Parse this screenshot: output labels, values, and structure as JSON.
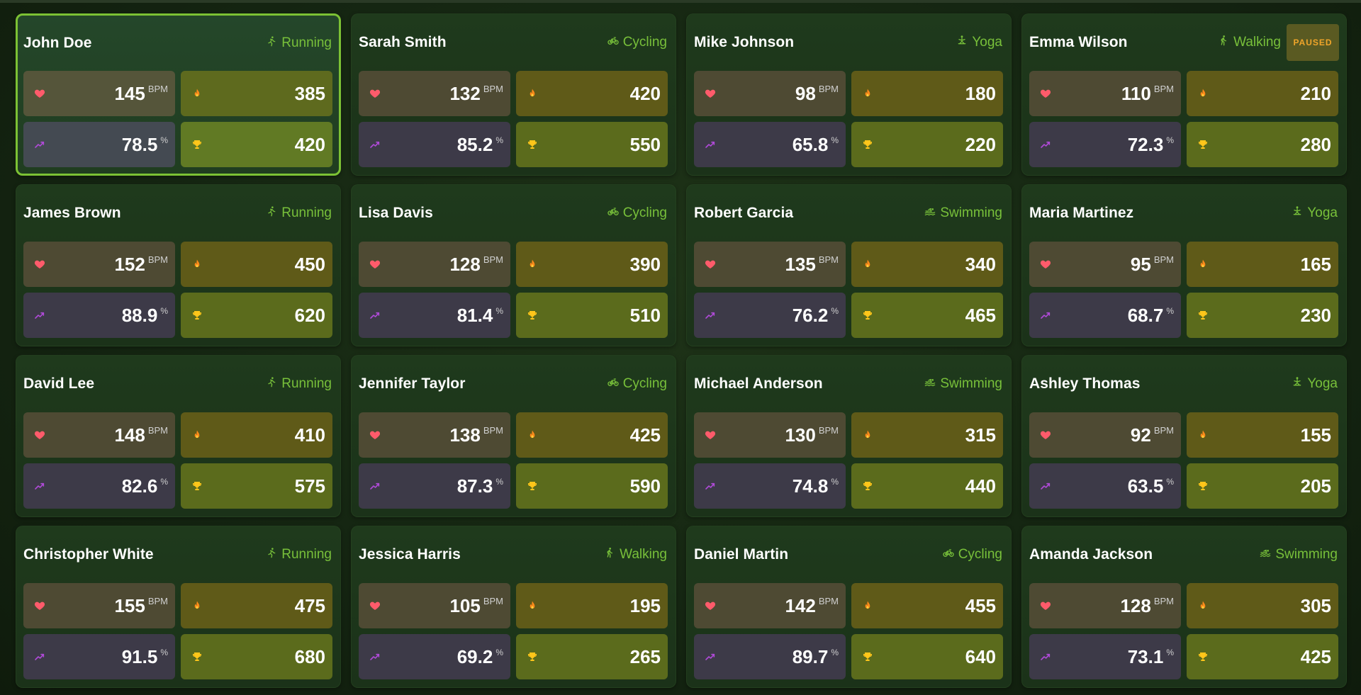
{
  "units": {
    "heart_rate": "BPM",
    "efficiency": "%"
  },
  "colors": {
    "accent": "#7cc234",
    "activity_text": "#78c03a",
    "paused_text": "#f0a52a",
    "heart_icon": "#ff5b6b",
    "flame_icon": "#ff8a1a",
    "trend_icon": "#b04ad8",
    "trophy_icon": "#ffc61a"
  },
  "icons": {
    "heart": "heart-icon",
    "calories": "flame-icon",
    "efficiency": "trend-up-icon",
    "score": "trophy-icon"
  },
  "cards": [
    {
      "name": "John Doe",
      "activity": "Running",
      "activity_icon": "running-icon",
      "heart_rate": "145",
      "calories": "385",
      "efficiency": "78.5",
      "score": "420",
      "selected": true,
      "status": ""
    },
    {
      "name": "Sarah Smith",
      "activity": "Cycling",
      "activity_icon": "cycling-icon",
      "heart_rate": "132",
      "calories": "420",
      "efficiency": "85.2",
      "score": "550",
      "selected": false,
      "status": ""
    },
    {
      "name": "Mike Johnson",
      "activity": "Yoga",
      "activity_icon": "yoga-icon",
      "heart_rate": "98",
      "calories": "180",
      "efficiency": "65.8",
      "score": "220",
      "selected": false,
      "status": ""
    },
    {
      "name": "Emma Wilson",
      "activity": "Walking",
      "activity_icon": "walking-icon",
      "heart_rate": "110",
      "calories": "210",
      "efficiency": "72.3",
      "score": "280",
      "selected": false,
      "status": "PAUSED"
    },
    {
      "name": "James Brown",
      "activity": "Running",
      "activity_icon": "running-icon",
      "heart_rate": "152",
      "calories": "450",
      "efficiency": "88.9",
      "score": "620",
      "selected": false,
      "status": ""
    },
    {
      "name": "Lisa Davis",
      "activity": "Cycling",
      "activity_icon": "cycling-icon",
      "heart_rate": "128",
      "calories": "390",
      "efficiency": "81.4",
      "score": "510",
      "selected": false,
      "status": ""
    },
    {
      "name": "Robert Garcia",
      "activity": "Swimming",
      "activity_icon": "swimming-icon",
      "heart_rate": "135",
      "calories": "340",
      "efficiency": "76.2",
      "score": "465",
      "selected": false,
      "status": ""
    },
    {
      "name": "Maria Martinez",
      "activity": "Yoga",
      "activity_icon": "yoga-icon",
      "heart_rate": "95",
      "calories": "165",
      "efficiency": "68.7",
      "score": "230",
      "selected": false,
      "status": ""
    },
    {
      "name": "David Lee",
      "activity": "Running",
      "activity_icon": "running-icon",
      "heart_rate": "148",
      "calories": "410",
      "efficiency": "82.6",
      "score": "575",
      "selected": false,
      "status": ""
    },
    {
      "name": "Jennifer Taylor",
      "activity": "Cycling",
      "activity_icon": "cycling-icon",
      "heart_rate": "138",
      "calories": "425",
      "efficiency": "87.3",
      "score": "590",
      "selected": false,
      "status": ""
    },
    {
      "name": "Michael Anderson",
      "activity": "Swimming",
      "activity_icon": "swimming-icon",
      "heart_rate": "130",
      "calories": "315",
      "efficiency": "74.8",
      "score": "440",
      "selected": false,
      "status": ""
    },
    {
      "name": "Ashley Thomas",
      "activity": "Yoga",
      "activity_icon": "yoga-icon",
      "heart_rate": "92",
      "calories": "155",
      "efficiency": "63.5",
      "score": "205",
      "selected": false,
      "status": ""
    },
    {
      "name": "Christopher White",
      "activity": "Running",
      "activity_icon": "running-icon",
      "heart_rate": "155",
      "calories": "475",
      "efficiency": "91.5",
      "score": "680",
      "selected": false,
      "status": ""
    },
    {
      "name": "Jessica Harris",
      "activity": "Walking",
      "activity_icon": "walking-icon",
      "heart_rate": "105",
      "calories": "195",
      "efficiency": "69.2",
      "score": "265",
      "selected": false,
      "status": ""
    },
    {
      "name": "Daniel Martin",
      "activity": "Cycling",
      "activity_icon": "cycling-icon",
      "heart_rate": "142",
      "calories": "455",
      "efficiency": "89.7",
      "score": "640",
      "selected": false,
      "status": ""
    },
    {
      "name": "Amanda Jackson",
      "activity": "Swimming",
      "activity_icon": "swimming-icon",
      "heart_rate": "128",
      "calories": "305",
      "efficiency": "73.1",
      "score": "425",
      "selected": false,
      "status": ""
    }
  ]
}
